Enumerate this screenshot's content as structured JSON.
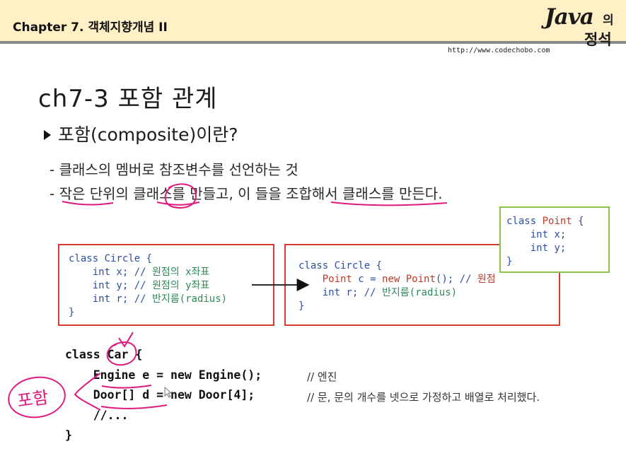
{
  "header": {
    "chapter": "Chapter 7. 객체지향개념 II",
    "logo_java": "Java",
    "logo_ui": "의",
    "logo_jeongseok": "정석",
    "url": "http://www.codechobo.com"
  },
  "slide": {
    "title": "ch7-3 포함 관계",
    "question": "포함(composite)이란?",
    "points": [
      "- 클래스의 멤버로 참조변수를 선언하는 것",
      "- 작은 단위의 클래스를 만들고, 이 들을 조합해서 클래스를 만든다."
    ]
  },
  "box_before": {
    "line1": "class Circle {",
    "line2_code": "    int x; // ",
    "line2_cm": "원점의 x좌표",
    "line3_code": "    int y; // ",
    "line3_cm": "원점의 y좌표",
    "line4_code": "    int r; // ",
    "line4_cm": "반지름(radius)",
    "line5": "}"
  },
  "box_after": {
    "line1": "class Circle {",
    "line2_pre": "    ",
    "line2_type": "Point",
    "line2_mid": " c = ",
    "line2_new": "new",
    "line2_ctor": " Point",
    "line2_end": "(); // ",
    "line2_cm": "원점",
    "line3_code": "    int r; // ",
    "line3_cm": "반지름(radius)",
    "line4": "}"
  },
  "box_point": {
    "line1_kw": "class ",
    "line1_name": "Point",
    "line1_end": " {",
    "line2": "    int x;",
    "line3": "    int y;",
    "line4": "}"
  },
  "car": {
    "line1": "class Car {",
    "line2": "    Engine e = new Engine();",
    "line3": "    Door[] d = new Door[4];",
    "line4": "    //...",
    "line5": "}",
    "comment_engine": "// 엔진",
    "comment_door": "// 문, 문의 개수를 넷으로 가정하고 배열로 처리했다."
  },
  "annotation": {
    "handwriting": "포함"
  },
  "colors": {
    "header_bg": "#fff0c6",
    "box_red": "#d83a2e",
    "box_green": "#8bc34a",
    "ink_magenta": "#e0197d"
  }
}
